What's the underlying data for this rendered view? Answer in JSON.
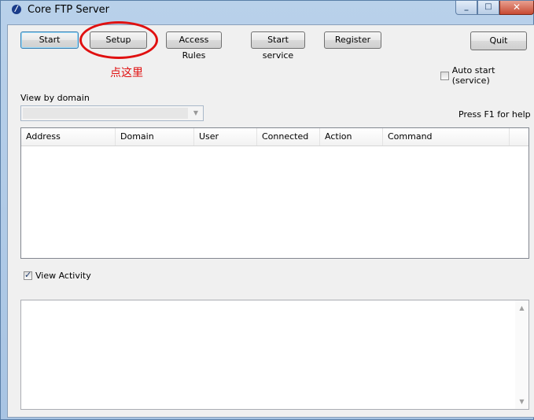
{
  "window": {
    "title": "Core FTP Server",
    "app_icon_glyph": "/",
    "controls": {
      "minimize": "_",
      "maximize": "□",
      "close": "✕"
    }
  },
  "toolbar": {
    "start": "Start",
    "setup": "Setup",
    "access_rules": "Access Rules",
    "start_service": "Start service",
    "register": "Register",
    "quit": "Quit"
  },
  "annotation": {
    "text": "点这里",
    "color": "#e01010"
  },
  "options": {
    "auto_start_label": "Auto start (service)",
    "auto_start_checked": false,
    "view_by_domain_label": "View by domain",
    "domain_selected": "",
    "help_hint": "Press F1 for help"
  },
  "connections_table": {
    "columns": [
      "Address",
      "Domain",
      "User",
      "Connected",
      "Action",
      "Command"
    ],
    "rows": []
  },
  "activity": {
    "view_activity_label": "View Activity",
    "view_activity_checked": true,
    "log_text": ""
  },
  "scrollbar": {
    "up": "▲",
    "down": "▼"
  },
  "combo_arrow": "▼",
  "colors": {
    "accent_default_button": "#3c7fb1",
    "title_bar": "#b9d1ea",
    "close_button": "#c84a33"
  }
}
